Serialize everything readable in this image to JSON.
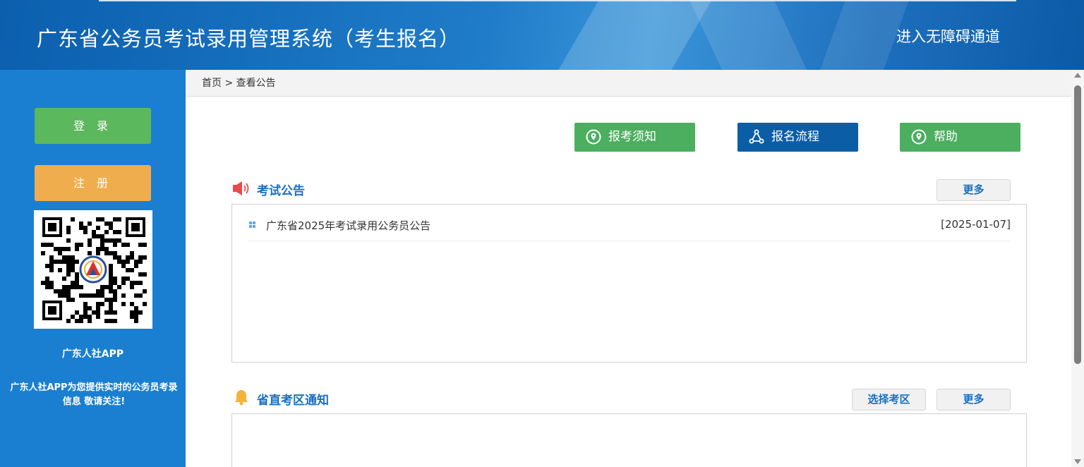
{
  "header": {
    "title": "广东省公务员考试录用管理系统（考生报名）",
    "accessibility_link": "进入无障碍通道"
  },
  "sidebar": {
    "login_label": "登 录",
    "register_label": "注 册",
    "app_name": "广东人社APP",
    "app_description": "广东人社APP为您提供实时的公务员考录信息 敬请关注!"
  },
  "breadcrumb": {
    "home": "首页",
    "separator": ">",
    "current": "查看公告"
  },
  "tabs": [
    {
      "label": "报考须知",
      "icon": "location-pin-icon",
      "color": "#4cae5f"
    },
    {
      "label": "报名流程",
      "icon": "flow-cycle-icon",
      "color": "#0b5ea6"
    },
    {
      "label": "帮助",
      "icon": "location-pin-icon",
      "color": "#4cae5f"
    }
  ],
  "exam_notices": {
    "title": "考试公告",
    "icon": "speaker-icon",
    "more_label": "更多",
    "items": [
      {
        "title": "广东省2025年考试录用公务员公告",
        "date": "[2025-01-07]"
      }
    ]
  },
  "district_notices": {
    "title": "省直考区通知",
    "icon": "bell-icon",
    "select_area_label": "选择考区",
    "more_label": "更多",
    "items": []
  },
  "colors": {
    "header_blue": "#0b5fae",
    "sidebar_blue": "#1a7fd0",
    "green": "#5cb85c",
    "orange": "#f0ad4e",
    "link_blue": "#1a6fc0"
  }
}
